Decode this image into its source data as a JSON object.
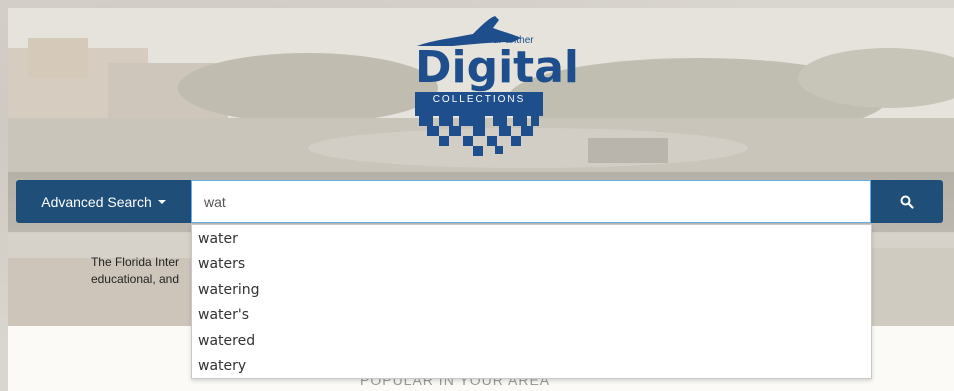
{
  "logo": {
    "small": "dPanther",
    "big": "Digital",
    "bar": "COLLECTIONS"
  },
  "search": {
    "advanced_label": "Advanced Search",
    "query": "wat",
    "suggestions": [
      "water",
      "waters",
      "watering",
      "water's",
      "watered",
      "watery"
    ],
    "button_icon": "search-icon"
  },
  "intro": {
    "line1": "The Florida Inter",
    "line2": "educational, and"
  },
  "section": {
    "title": "POPULAR IN YOUR AREA"
  },
  "colors": {
    "primary": "#1f4e79",
    "logo": "#1f4e8c",
    "focus_border": "#66afe9"
  }
}
